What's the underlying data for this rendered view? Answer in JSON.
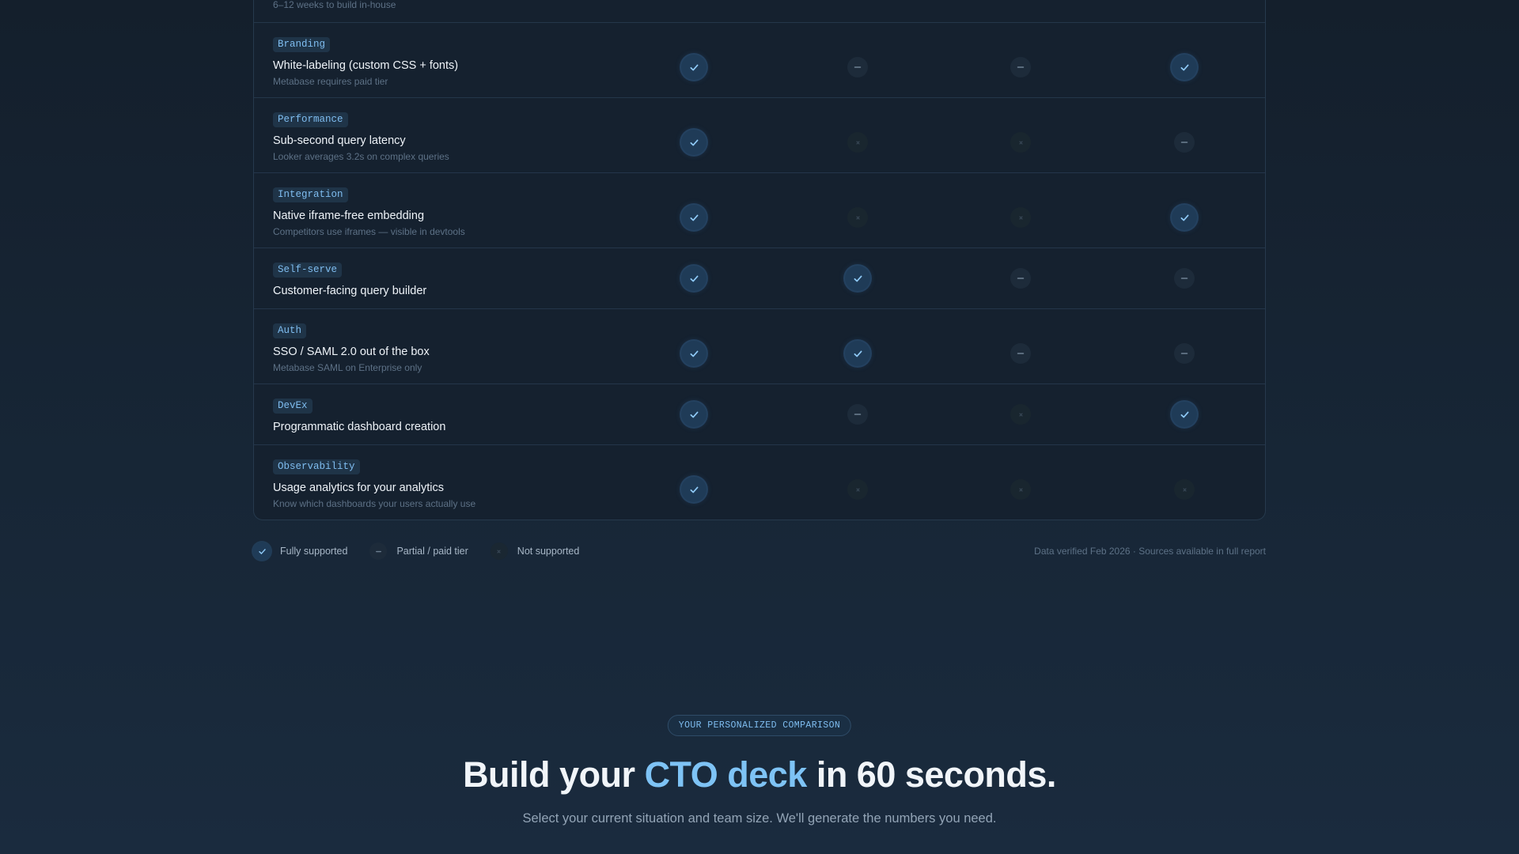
{
  "table": {
    "rows": [
      {
        "tag": "",
        "title": "",
        "note": "6–12 weeks to build in-house",
        "cells": []
      },
      {
        "tag": "Branding",
        "title": "White-labeling (custom CSS + fonts)",
        "note": "Metabase requires paid tier",
        "cells": [
          "full",
          "partial",
          "partial",
          "full"
        ]
      },
      {
        "tag": "Performance",
        "title": "Sub-second query latency",
        "note": "Looker averages 3.2s on complex queries",
        "cells": [
          "full",
          "none",
          "none",
          "partial"
        ]
      },
      {
        "tag": "Integration",
        "title": "Native iframe-free embedding",
        "note": "Competitors use iframes — visible in devtools",
        "cells": [
          "full",
          "none",
          "none",
          "full"
        ]
      },
      {
        "tag": "Self-serve",
        "title": "Customer-facing query builder",
        "note": "",
        "cells": [
          "full",
          "full",
          "partial",
          "partial"
        ]
      },
      {
        "tag": "Auth",
        "title": "SSO / SAML 2.0 out of the box",
        "note": "Metabase SAML on Enterprise only",
        "cells": [
          "full",
          "full",
          "partial",
          "partial"
        ]
      },
      {
        "tag": "DevEx",
        "title": "Programmatic dashboard creation",
        "note": "",
        "cells": [
          "full",
          "partial",
          "none",
          "full"
        ]
      },
      {
        "tag": "Observability",
        "title": "Usage analytics for your analytics",
        "note": "Know which dashboards your users actually use",
        "cells": [
          "full",
          "none",
          "none",
          "none"
        ]
      }
    ]
  },
  "legend": {
    "full_label": "Fully supported",
    "partial_label": "Partial / paid tier",
    "none_label": "Not supported",
    "note": "Data verified Feb 2026 · Sources available in full report"
  },
  "cta": {
    "pill": "YOUR PERSONALIZED COMPARISON",
    "headline_pre": "Build your ",
    "headline_accent": "CTO deck",
    "headline_post": " in 60 seconds.",
    "subline": "Select your current situation and team size. We'll generate the numbers you need."
  },
  "colors": {
    "accent": "#7ec3f5",
    "check": "#8fcaf7",
    "dash": "#6f8193",
    "cross": "#3d4d5c"
  },
  "icons": {
    "full": "check-icon",
    "partial": "dash-icon",
    "none": "x-icon"
  }
}
